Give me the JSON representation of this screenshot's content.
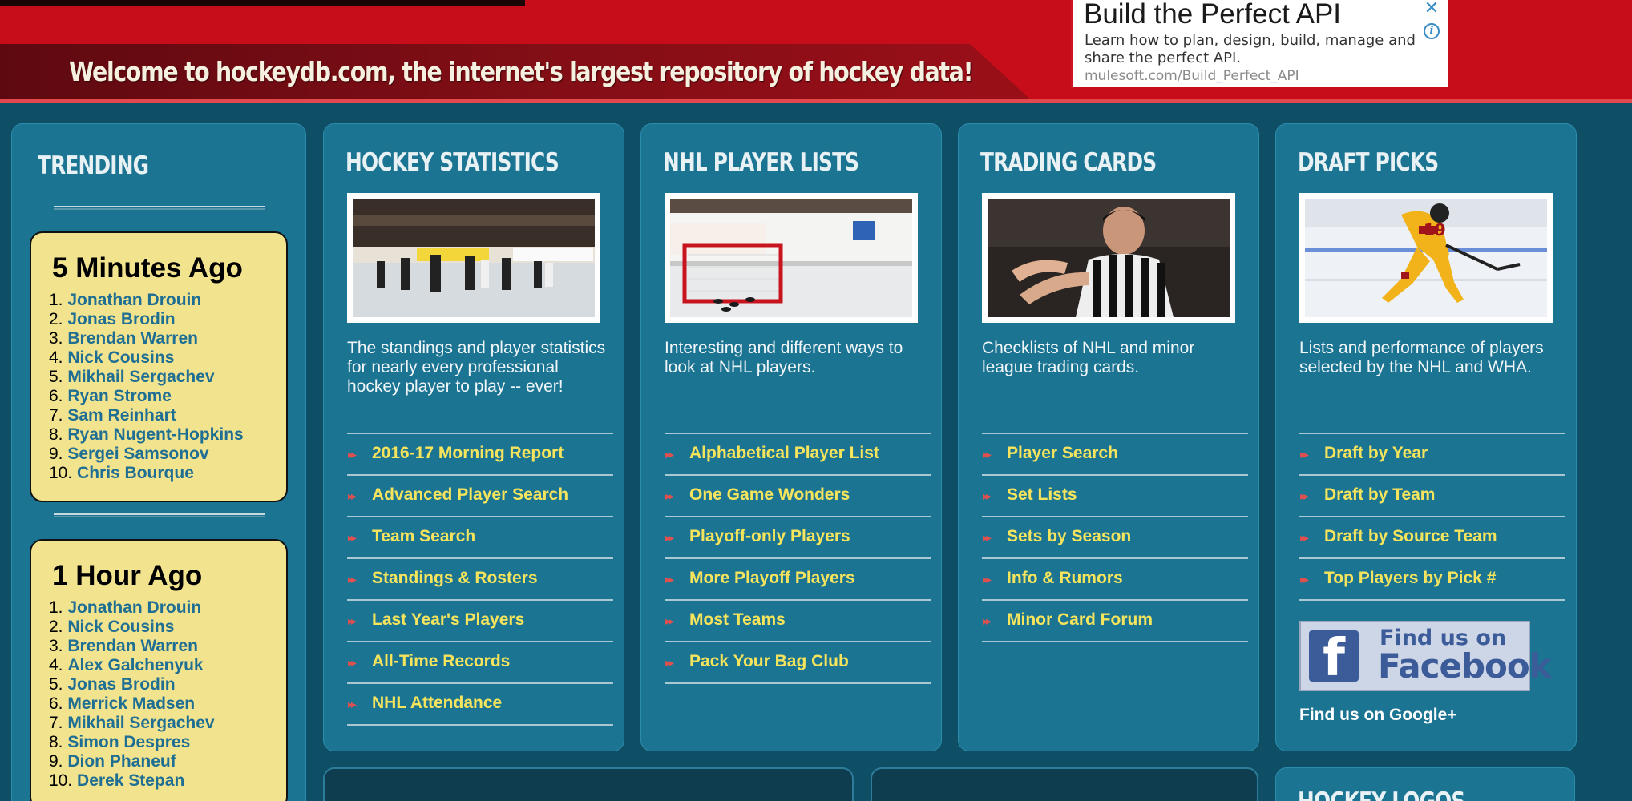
{
  "header": {
    "welcome": "Welcome to hockeydb.com, the internet's largest repository of hockey data!"
  },
  "ad": {
    "title": "Build the Perfect API",
    "description": "Learn how to plan, design, build, manage and share the perfect API.",
    "url": "mulesoft.com/Build_Perfect_API",
    "close_glyph": "✕",
    "info_glyph": "i"
  },
  "trending": {
    "title": "TRENDING",
    "groups": [
      {
        "heading": "5 Minutes Ago",
        "players": [
          "Jonathan Drouin",
          "Jonas Brodin",
          "Brendan Warren",
          "Nick Cousins",
          "Mikhail Sergachev",
          "Ryan Strome",
          "Sam Reinhart",
          "Ryan Nugent-Hopkins",
          "Sergei Samsonov",
          "Chris Bourque"
        ]
      },
      {
        "heading": "1 Hour Ago",
        "players": [
          "Jonathan Drouin",
          "Nick Cousins",
          "Brendan Warren",
          "Alex Galchenyuk",
          "Jonas Brodin",
          "Merrick Madsen",
          "Mikhail Sergachev",
          "Simon Despres",
          "Dion Phaneuf",
          "Derek Stepan"
        ]
      }
    ]
  },
  "sections": [
    {
      "title": "HOCKEY STATISTICS",
      "description": "The standings and player statistics for nearly every professional hockey player to play -- ever!",
      "links": [
        "2016-17 Morning Report",
        "Advanced Player Search",
        "Team Search",
        "Standings & Rosters",
        "Last Year's Players",
        "All-Time Records",
        "NHL Attendance"
      ]
    },
    {
      "title": "NHL PLAYER LISTS",
      "description": "Interesting and different ways to look at NHL players.",
      "links": [
        "Alphabetical Player List",
        "One Game Wonders",
        "Playoff-only Players",
        "More Playoff Players",
        "Most Teams",
        "Pack Your Bag Club"
      ]
    },
    {
      "title": "TRADING CARDS",
      "description": "Checklists of NHL and minor league trading cards.",
      "links": [
        "Player Search",
        "Set Lists",
        "Sets by Season",
        "Info & Rumors",
        "Minor Card Forum"
      ]
    },
    {
      "title": "DRAFT PICKS",
      "description": "Lists and performance of players selected by the NHL and WHA.",
      "links": [
        "Draft by Year",
        "Draft by Team",
        "Draft by Source Team",
        "Top Players by Pick #"
      ]
    }
  ],
  "social": {
    "facebook_f": "f",
    "facebook_line1": "Find us on",
    "facebook_line2": "Facebook",
    "google_plus": "Find us on Google+"
  },
  "hockey_logos": {
    "title": "HOCKEY LOGOS"
  },
  "link_arrow": "▸▸",
  "colors": {
    "header_red": "#c80d1a",
    "panel_blue": "#1c7493",
    "page_bg": "#0f4f66",
    "link_yellow": "#f6e55c",
    "trend_box": "#f2e38e"
  }
}
